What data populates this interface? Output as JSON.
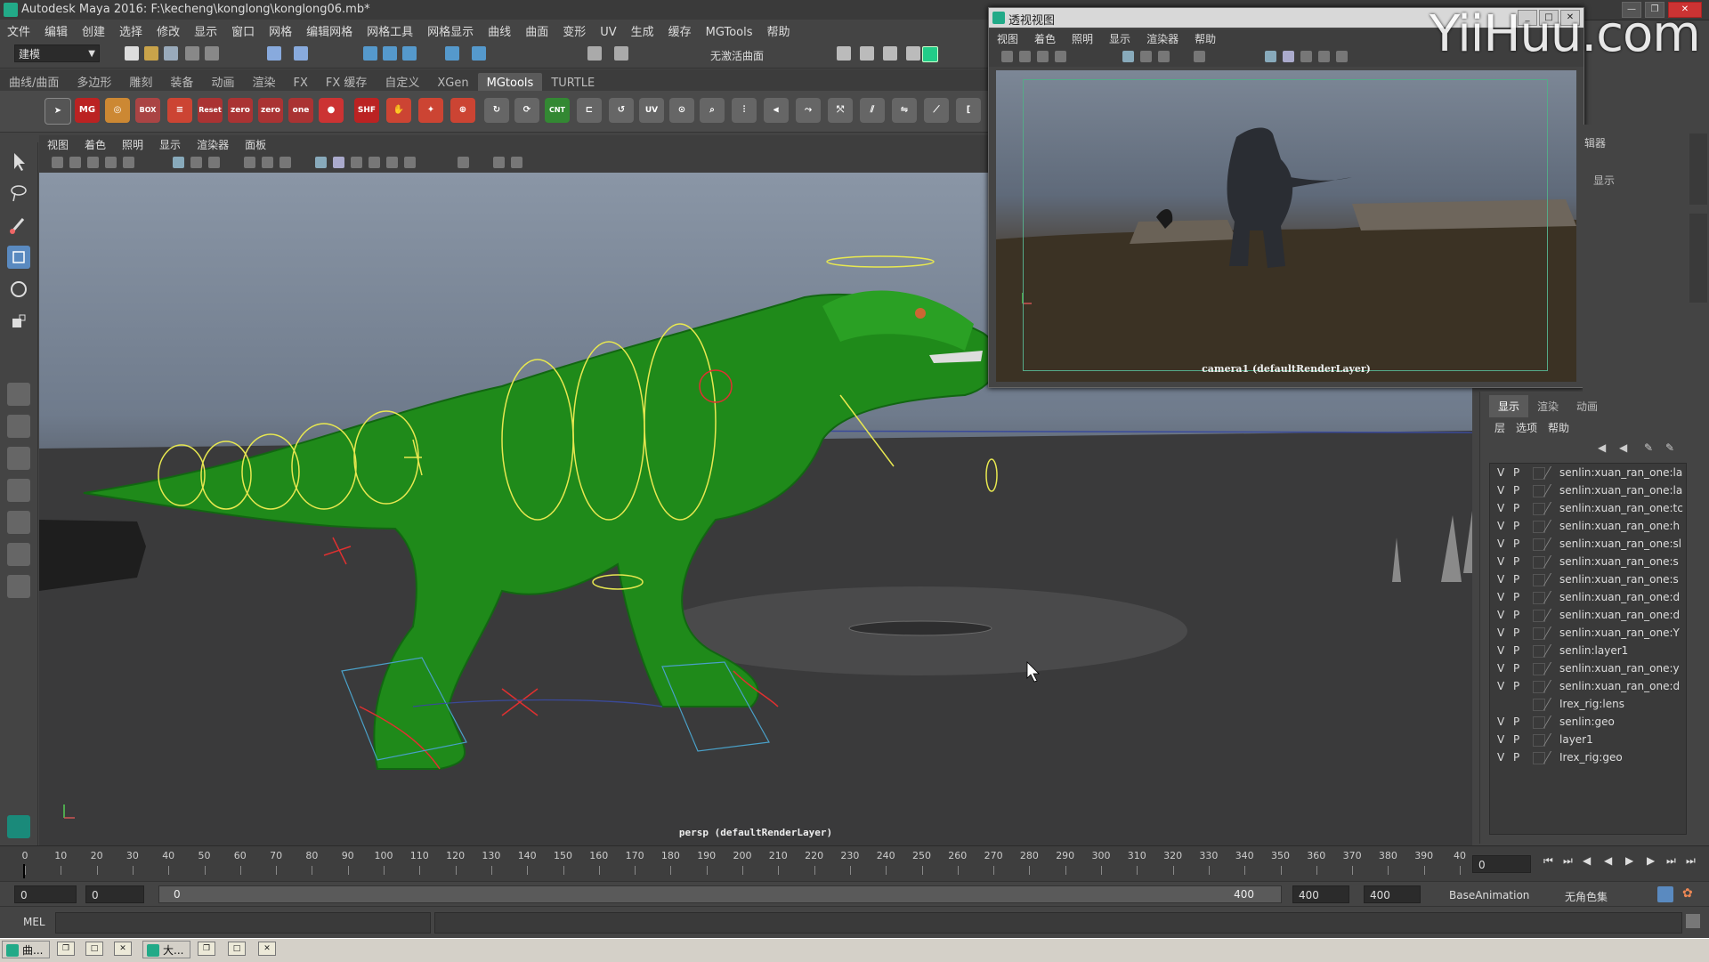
{
  "window": {
    "title": "Autodesk Maya 2016: F:\\kecheng\\konglong\\konglong06.mb*"
  },
  "menubar": [
    "文件",
    "编辑",
    "创建",
    "选择",
    "修改",
    "显示",
    "窗口",
    "网格",
    "编辑网格",
    "网格工具",
    "网格显示",
    "曲线",
    "曲面",
    "变形",
    "UV",
    "生成",
    "缓存",
    "MGTools",
    "帮助"
  ],
  "toolbar": {
    "workspace": "建模",
    "surface_label": "无激活曲面"
  },
  "shelf_tabs": [
    "曲线/曲面",
    "多边形",
    "雕刻",
    "装备",
    "动画",
    "渲染",
    "FX",
    "FX 缓存",
    "自定义",
    "XGen",
    "MGtools",
    "TURTLE"
  ],
  "shelf_active": "MGtools",
  "shelf_icons": [
    "MG",
    "BOX",
    "Reset",
    "zero",
    "zero",
    "one",
    "SHF",
    "CNT",
    "UV"
  ],
  "panel_menu": [
    "视图",
    "着色",
    "照明",
    "显示",
    "渲染器",
    "面板"
  ],
  "viewport": {
    "label": "persp (defaultRenderLayer)"
  },
  "float_window": {
    "title": "透视视图",
    "menu": [
      "视图",
      "着色",
      "照明",
      "显示",
      "渲染器",
      "帮助"
    ],
    "camera_label": "camera1 (defaultRenderLayer)"
  },
  "watermark": "YiiHuu.com",
  "right_side": {
    "header": "辑器",
    "item": "显示"
  },
  "layer_panel": {
    "tabs": [
      "显示",
      "渲染",
      "动画"
    ],
    "menu": [
      "层",
      "选项",
      "帮助"
    ],
    "layers": [
      {
        "v": "V",
        "p": "P",
        "name": "senlin:xuan_ran_one:la"
      },
      {
        "v": "V",
        "p": "P",
        "name": "senlin:xuan_ran_one:la"
      },
      {
        "v": "V",
        "p": "P",
        "name": "senlin:xuan_ran_one:tc"
      },
      {
        "v": "V",
        "p": "P",
        "name": "senlin:xuan_ran_one:h"
      },
      {
        "v": "V",
        "p": "P",
        "name": "senlin:xuan_ran_one:sl"
      },
      {
        "v": "V",
        "p": "P",
        "name": "senlin:xuan_ran_one:s"
      },
      {
        "v": "V",
        "p": "P",
        "name": "senlin:xuan_ran_one:s"
      },
      {
        "v": "V",
        "p": "P",
        "name": "senlin:xuan_ran_one:d"
      },
      {
        "v": "V",
        "p": "P",
        "name": "senlin:xuan_ran_one:d"
      },
      {
        "v": "V",
        "p": "P",
        "name": "senlin:xuan_ran_one:Y"
      },
      {
        "v": "V",
        "p": "P",
        "name": "senlin:layer1"
      },
      {
        "v": "V",
        "p": "P",
        "name": "senlin:xuan_ran_one:y"
      },
      {
        "v": "V",
        "p": "P",
        "name": "senlin:xuan_ran_one:d"
      },
      {
        "v": "",
        "p": "",
        "name": "Irex_rig:lens"
      },
      {
        "v": "V",
        "p": "P",
        "name": "senlin:geo"
      },
      {
        "v": "V",
        "p": "P",
        "name": "layer1"
      },
      {
        "v": "V",
        "p": "P",
        "name": "Irex_rig:geo"
      }
    ]
  },
  "timeline": {
    "ticks": [
      "0",
      "10",
      "20",
      "30",
      "40",
      "50",
      "60",
      "70",
      "80",
      "90",
      "100",
      "110",
      "120",
      "130",
      "140",
      "150",
      "160",
      "170",
      "180",
      "190",
      "200",
      "210",
      "220",
      "230",
      "240",
      "250",
      "260",
      "270",
      "280",
      "290",
      "300",
      "310",
      "320",
      "330",
      "340",
      "350",
      "360",
      "370",
      "380",
      "390",
      "40"
    ],
    "current_frame": "0"
  },
  "range": {
    "start": "0",
    "start_inner": "0",
    "slider_lo": "0",
    "slider_hi": "400",
    "end_inner": "400",
    "end": "400",
    "anim_layer": "BaseAnimation",
    "char_set": "无角色集"
  },
  "mel": {
    "label": "MEL"
  },
  "taskbar": [
    {
      "label": "曲..."
    },
    {
      "label": "大..."
    }
  ]
}
